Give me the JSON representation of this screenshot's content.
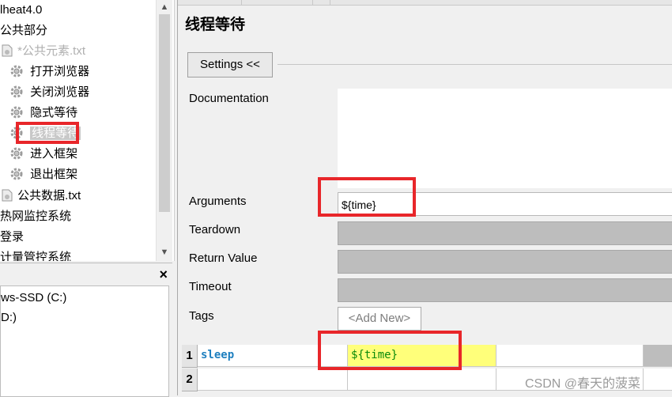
{
  "tree": {
    "items": [
      {
        "label": "lheat4.0"
      },
      {
        "label": "公共部分"
      },
      {
        "label": "*公共元素.txt"
      },
      {
        "label": "打开浏览器"
      },
      {
        "label": "关闭浏览器"
      },
      {
        "label": "隐式等待"
      },
      {
        "label": "线程等待"
      },
      {
        "label": "进入框架"
      },
      {
        "label": "退出框架"
      },
      {
        "label": "公共数据.txt"
      },
      {
        "label": "热网监控系统"
      },
      {
        "label": "登录"
      },
      {
        "label": "计量管控系统"
      }
    ]
  },
  "lower_pane": {
    "close_label": "×",
    "drives": [
      "ws-SSD (C:)",
      "D:)"
    ]
  },
  "editor": {
    "title": "线程等待",
    "settings_button": "Settings <<",
    "labels": {
      "documentation": "Documentation",
      "arguments": "Arguments",
      "teardown": "Teardown",
      "return_value": "Return Value",
      "timeout": "Timeout",
      "tags": "Tags"
    },
    "arguments_value": "${time}",
    "add_new": "<Add New>"
  },
  "grid": {
    "rows": [
      {
        "num": "1",
        "keyword": "sleep",
        "arg": "${time}"
      },
      {
        "num": "2",
        "keyword": "",
        "arg": ""
      }
    ]
  },
  "watermark": "CSDN @春天的菠菜",
  "colors": {
    "highlight_red": "#e8262a",
    "keyword_blue": "#1e7fbf",
    "arg_green": "#0a8a0a",
    "arg_bg_yellow": "#ffff7a"
  }
}
